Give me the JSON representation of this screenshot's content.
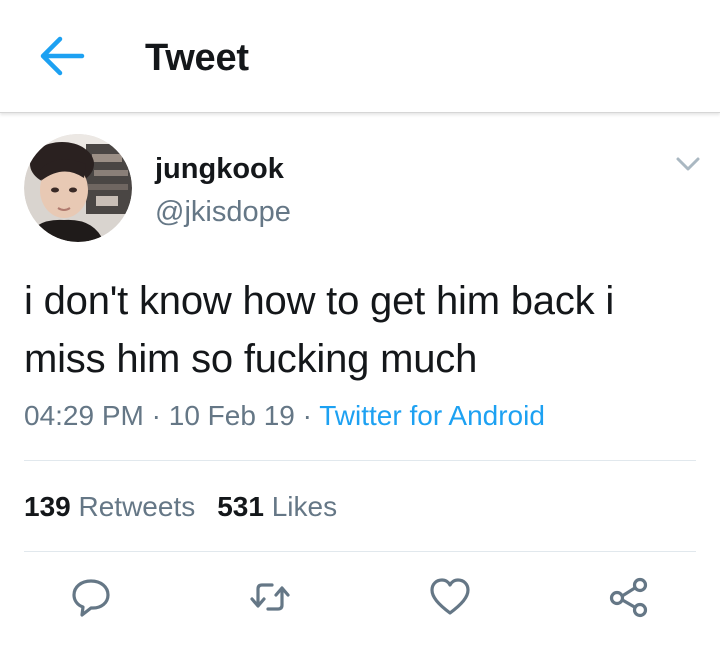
{
  "header": {
    "title": "Tweet",
    "back_icon": "arrow-left-icon",
    "accent_color": "#1da1f2"
  },
  "tweet": {
    "user": {
      "display_name": "jungkook",
      "handle": "@jkisdope"
    },
    "text": "i don't know how to get him back i miss him so fucking much",
    "meta": {
      "time": "04:29 PM",
      "separator": " · ",
      "date": "10 Feb 19",
      "source": "Twitter for Android"
    },
    "stats": {
      "retweets_count": "139",
      "retweets_label": "Retweets",
      "likes_count": "531",
      "likes_label": "Likes"
    },
    "actions": [
      "reply-icon",
      "retweet-icon",
      "like-icon",
      "share-icon"
    ]
  },
  "colors": {
    "text_primary": "#14171a",
    "text_secondary": "#657786",
    "link": "#1da1f2",
    "divider": "#e1e8ed"
  }
}
